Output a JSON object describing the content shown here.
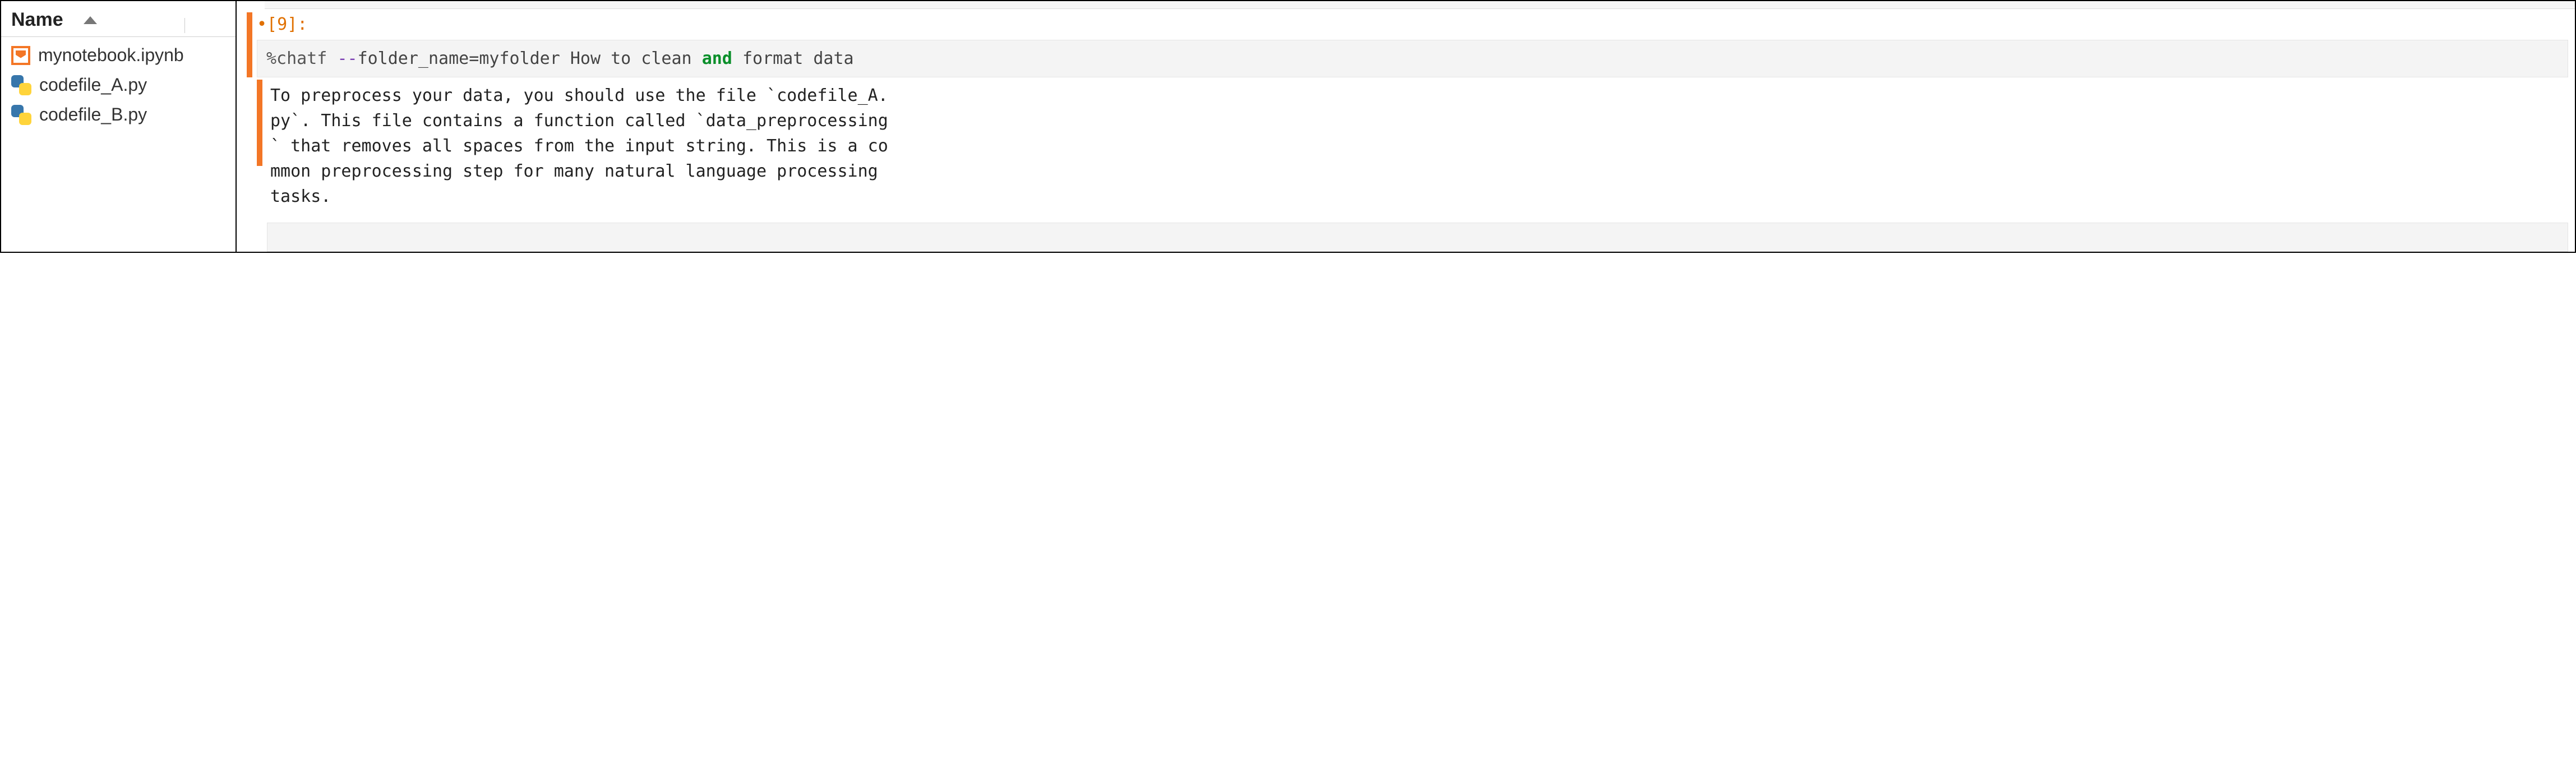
{
  "filebrowser": {
    "header": "Name",
    "items": [
      {
        "label": "mynotebook.ipynb",
        "icon": "notebook"
      },
      {
        "label": "codefile_A.py",
        "icon": "python"
      },
      {
        "label": "codefile_B.py",
        "icon": "python"
      }
    ]
  },
  "cell": {
    "exec_count": "9",
    "prompt_prefix": "•[",
    "prompt_suffix": "]:",
    "code": {
      "magic": "%chatf",
      "option_flag": "--",
      "option_name": "folder_name",
      "option_eq": "=",
      "option_val": "myfolder",
      "query_pre": "How to clean",
      "keyword": "and",
      "query_post": "format data"
    },
    "output": {
      "t1": "To preprocess your data, you should use the file `codefile_A.",
      "t2": "py`. This file contains a function called `data_preprocessing",
      "t3": "`  that removes all spaces from the input string. This is a co",
      "t4": "mmon preprocessing step for many natural language processing ",
      "t5": "tasks."
    }
  }
}
